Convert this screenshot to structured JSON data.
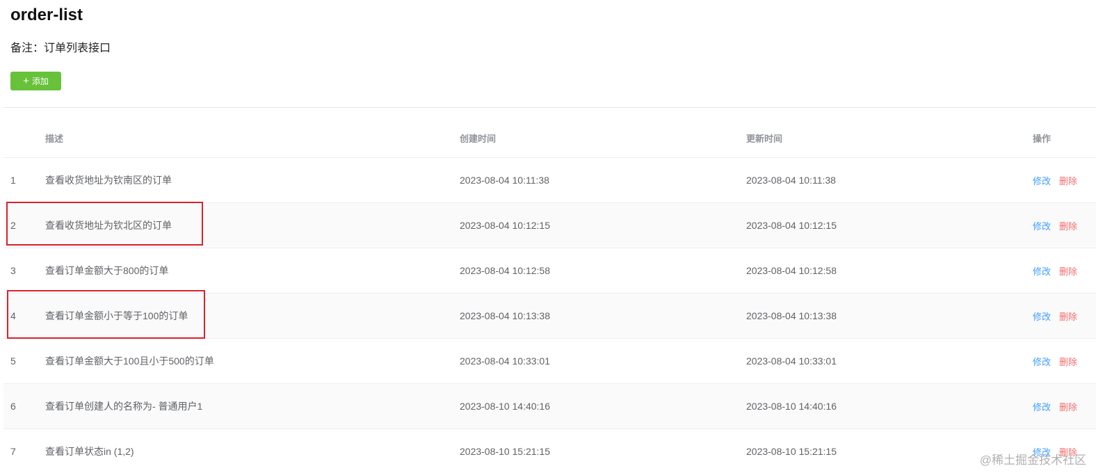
{
  "page": {
    "title": "order-list",
    "remark": "备注：订单列表接口",
    "add_button": {
      "icon": "plus-icon",
      "label": "添加"
    }
  },
  "table": {
    "headers": [
      "",
      "描述",
      "创建时间",
      "更新时间",
      "操作"
    ],
    "rows": [
      {
        "idx": "1",
        "desc": "查看收货地址为钦南区的订单",
        "created": "2023-08-04 10:11:38",
        "updated": "2023-08-04 10:11:38",
        "edit": "修改",
        "delete": "删除"
      },
      {
        "idx": "2",
        "desc": "查看收货地址为钦北区的订单",
        "created": "2023-08-04 10:12:15",
        "updated": "2023-08-04 10:12:15",
        "edit": "修改",
        "delete": "删除"
      },
      {
        "idx": "3",
        "desc": "查看订单金额大于800的订单",
        "created": "2023-08-04 10:12:58",
        "updated": "2023-08-04 10:12:58",
        "edit": "修改",
        "delete": "删除"
      },
      {
        "idx": "4",
        "desc": "查看订单金额小于等于100的订单",
        "created": "2023-08-04 10:13:38",
        "updated": "2023-08-04 10:13:38",
        "edit": "修改",
        "delete": "删除"
      },
      {
        "idx": "5",
        "desc": "查看订单金额大于100且小于500的订单",
        "created": "2023-08-04 10:33:01",
        "updated": "2023-08-04 10:33:01",
        "edit": "修改",
        "delete": "删除"
      },
      {
        "idx": "6",
        "desc": "查看订单创建人的名称为- 普通用户1",
        "created": "2023-08-10 14:40:16",
        "updated": "2023-08-10 14:40:16",
        "edit": "修改",
        "delete": "删除"
      },
      {
        "idx": "7",
        "desc": "查看订单状态in (1,2)",
        "created": "2023-08-10 15:21:15",
        "updated": "2023-08-10 15:21:15",
        "edit": "修改",
        "delete": "删除"
      }
    ]
  },
  "colors": {
    "add_button_bg": "#67c23a",
    "edit_link": "#409eff",
    "delete_link": "#f56c6c",
    "highlight_box": "#d9212b"
  },
  "watermark": "@稀土掘金技术社区"
}
